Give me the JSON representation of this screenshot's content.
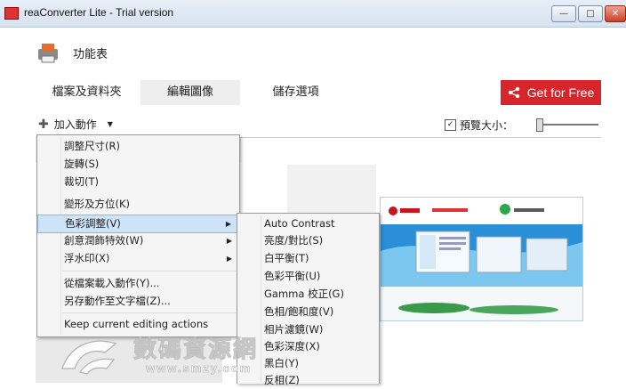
{
  "window": {
    "title": "reaConverter Lite - Trial version",
    "minimize": "—",
    "maximize": "□",
    "close": "✕"
  },
  "menubar": {
    "label": "功能表"
  },
  "tabs": [
    {
      "label": "檔案及資料夾"
    },
    {
      "label": "編輯圖像"
    },
    {
      "label": "儲存選項"
    }
  ],
  "get_free": {
    "label": "Get for Free",
    "icon": "share-icon",
    "color": "#d6262c"
  },
  "toolbar": {
    "add_action": "加入動作",
    "preview_checked": "✓",
    "preview_size": "預覽大小："
  },
  "main_menu": {
    "items": [
      {
        "label": "調整尺寸(R)"
      },
      {
        "label": "旋轉(S)"
      },
      {
        "label": "裁切(T)"
      },
      {
        "label": "變形及方位(K)"
      },
      {
        "label": "色彩調整(V)",
        "submenu": true
      },
      {
        "label": "創意潤飾特效(W)",
        "submenu": true
      },
      {
        "label": "浮水印(X)",
        "submenu": true
      },
      {
        "label": "從檔案載入動作(Y)..."
      },
      {
        "label": "另存動作至文字檔(Z)..."
      },
      {
        "label": "Keep current editing actions"
      }
    ]
  },
  "sub_menu": {
    "items": [
      {
        "label": "Auto Contrast"
      },
      {
        "label": "亮度/對比(S)"
      },
      {
        "label": "白平衡(T)"
      },
      {
        "label": "色彩平衡(U)"
      },
      {
        "label": "Gamma 校正(G)"
      },
      {
        "label": "色相/飽和度(V)"
      },
      {
        "label": "相片濾鏡(W)"
      },
      {
        "label": "色彩深度(X)"
      },
      {
        "label": "黑白(Y)"
      },
      {
        "label": "反相(Z)"
      }
    ]
  },
  "watermark": {
    "text": "數碼資源網",
    "url": "www.smzy.com"
  }
}
